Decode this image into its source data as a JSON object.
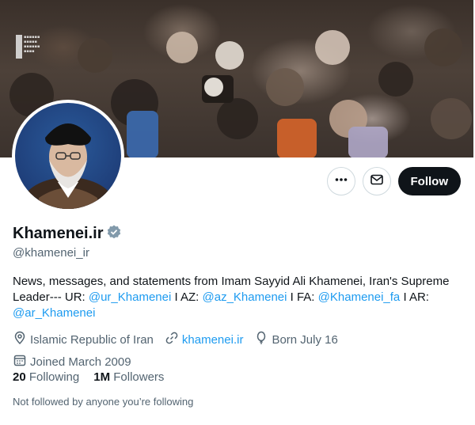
{
  "profile": {
    "display_name": "Khamenei.ir",
    "handle": "@khamenei_ir",
    "verified_icon": "verified-badge-icon",
    "bio": {
      "text_1": "News, messages, and statements from Imam Sayyid Ali Khamenei, Iran's Supreme Leader--- UR: ",
      "link_1": "@ur_Khamenei",
      "text_2": " I AZ: ",
      "link_2": "@az_Khamenei",
      "text_3": " I FA: ",
      "link_3": "@Khamenei_fa",
      "text_4": " I AR: ",
      "link_4": "@ar_Khamenei"
    },
    "location": "Islamic Republic of Iran",
    "website": "khamenei.ir",
    "birthday": "Born July 16",
    "joined": "Joined March 2009",
    "following_count": "20",
    "following_label": "Following",
    "followers_count": "1M",
    "followers_label": "Followers",
    "not_followed_text": "Not followed by anyone you’re following"
  },
  "actions": {
    "more_icon": "more-horizontal-icon",
    "message_icon": "envelope-icon",
    "follow_label": "Follow"
  },
  "colors": {
    "link": "#1d9bf0",
    "text_primary": "#0f1419",
    "text_secondary": "#536471",
    "follow_bg": "#0f1419",
    "verified": "#829aab"
  }
}
